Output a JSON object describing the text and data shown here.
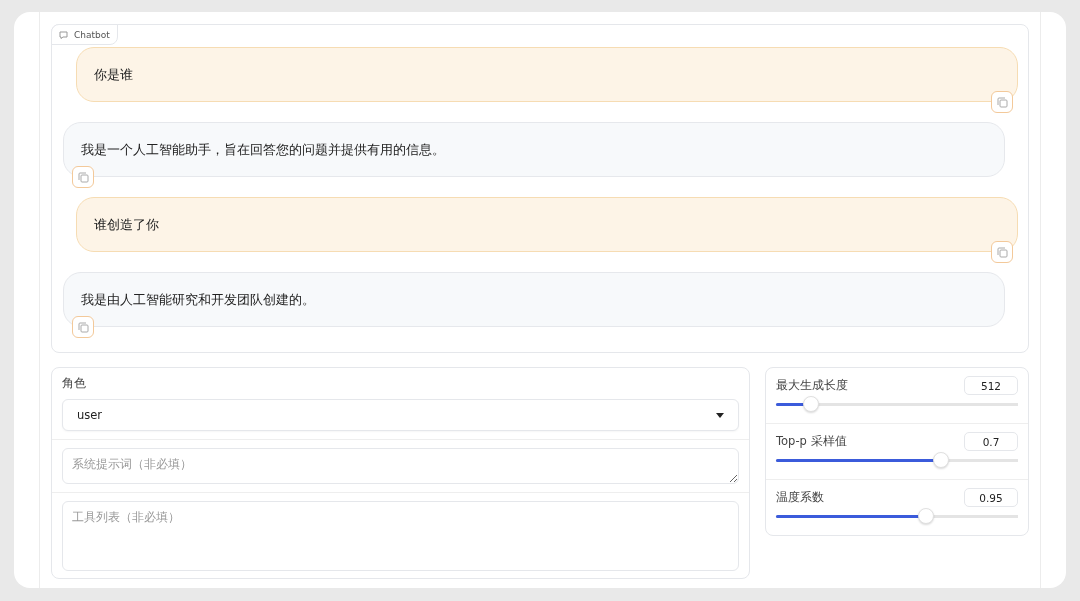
{
  "chatbot": {
    "label": "Chatbot",
    "messages": [
      {
        "kind": "user",
        "text": "你是谁"
      },
      {
        "kind": "assistant",
        "text": "我是一个人工智能助手，旨在回答您的问题并提供有用的信息。"
      },
      {
        "kind": "user",
        "text": "谁创造了你"
      },
      {
        "kind": "assistant",
        "text": "我是由人工智能研究和开发团队创建的。"
      }
    ]
  },
  "role_select": {
    "label": "角色",
    "value": "user"
  },
  "system_prompt": {
    "placeholder": "系统提示词（非必填）"
  },
  "tools": {
    "placeholder": "工具列表（非必填）"
  },
  "sliders": [
    {
      "label": "最大生成长度",
      "value": "512",
      "level": 0.145
    },
    {
      "label": "Top-p 采样值",
      "value": "0.7",
      "level": 0.68
    },
    {
      "label": "温度系数",
      "value": "0.95",
      "level": 0.62
    }
  ]
}
